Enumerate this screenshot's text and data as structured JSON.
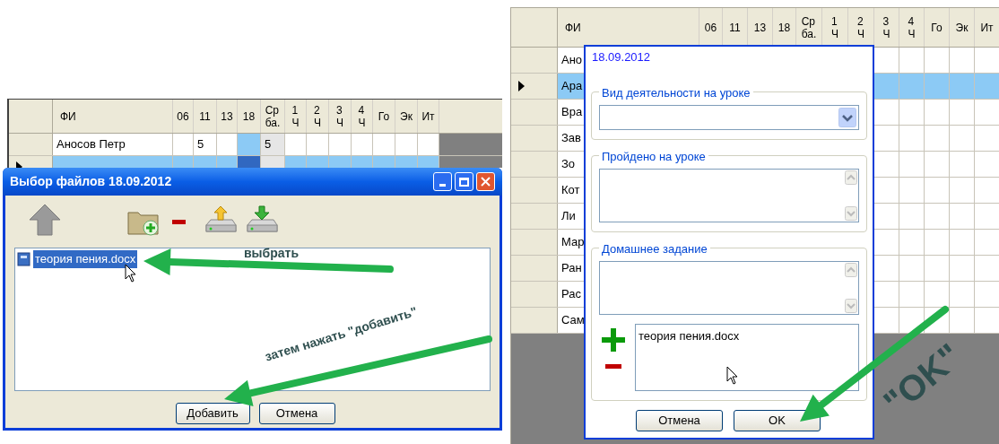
{
  "file_dialog_screen": {
    "grid": {
      "columns": [
        {
          "label": "ФИ",
          "kind": "name",
          "selected": false
        },
        {
          "label": "06",
          "kind": "grade",
          "selected": false
        },
        {
          "label": "11",
          "kind": "grade",
          "selected": false
        },
        {
          "label": "13",
          "kind": "grade",
          "selected": false
        },
        {
          "label": "18",
          "kind": "grade",
          "selected": true
        },
        {
          "label": "Ср ба.",
          "kind": "average",
          "selected": false
        },
        {
          "label": "1 Ч",
          "kind": "grade",
          "selected": false
        },
        {
          "label": "2 Ч",
          "kind": "grade",
          "selected": false
        },
        {
          "label": "3 Ч",
          "kind": "grade",
          "selected": false
        },
        {
          "label": "4 Ч",
          "kind": "grade",
          "selected": false
        },
        {
          "label": "Го",
          "kind": "grade",
          "selected": false
        },
        {
          "label": "Эк",
          "kind": "grade",
          "selected": false
        },
        {
          "label": "Ит",
          "kind": "grade",
          "selected": false
        }
      ],
      "rows": [
        {
          "selected": false,
          "cells": [
            "Аносов Петр",
            null,
            "5",
            null,
            null,
            "5"
          ]
        },
        {
          "selected": true,
          "cells": []
        }
      ]
    },
    "window": {
      "title": "Выбор файлов 18.09.2012",
      "files": [
        {
          "name": "теория пения.docx",
          "selected": true
        }
      ],
      "buttons": [
        "Добавить",
        "Отмена"
      ]
    },
    "annotations": [
      "выбрать",
      "затем нажать \"добавить\""
    ]
  },
  "lesson_screen": {
    "grid": {
      "columns": [
        {
          "label": "ФИ",
          "kind": "name"
        },
        {
          "label": "06"
        },
        {
          "label": "11"
        },
        {
          "label": "13"
        },
        {
          "label": "18"
        },
        {
          "label": "Ср ба."
        },
        {
          "label": "1 Ч"
        },
        {
          "label": "2 Ч"
        },
        {
          "label": "3 Ч"
        },
        {
          "label": "4 Ч"
        },
        {
          "label": "Го"
        },
        {
          "label": "Эк"
        },
        {
          "label": "Ит"
        }
      ],
      "rows": [
        {
          "selected": false,
          "cells": [
            "Ано"
          ]
        },
        {
          "selected": true,
          "cells": [
            "Ара"
          ]
        },
        {
          "selected": false,
          "cells": [
            "Вра"
          ]
        },
        {
          "selected": false,
          "cells": [
            "Зав"
          ]
        },
        {
          "selected": false,
          "cells": [
            "Зо"
          ]
        },
        {
          "selected": false,
          "cells": [
            "Кот"
          ]
        },
        {
          "selected": false,
          "cells": [
            "Ли"
          ]
        },
        {
          "selected": false,
          "cells": [
            "Мар"
          ]
        },
        {
          "selected": false,
          "cells": [
            "Ран"
          ]
        },
        {
          "selected": false,
          "cells": [
            "Рас"
          ]
        },
        {
          "selected": false,
          "cells": [
            "Сам"
          ]
        }
      ]
    },
    "dialog": {
      "date": "18.09.2012",
      "groups": [
        {
          "label": "Вид деятельности на уроке",
          "kind": "combo"
        },
        {
          "label": "Пройдено на уроке",
          "kind": "memo"
        },
        {
          "label": "Домашнее задание",
          "kind": "memo",
          "attachments": [
            "теория пения.docx"
          ]
        }
      ],
      "buttons": [
        "Отмена",
        "OK"
      ]
    },
    "annotations": [
      "\"OK\""
    ]
  }
}
